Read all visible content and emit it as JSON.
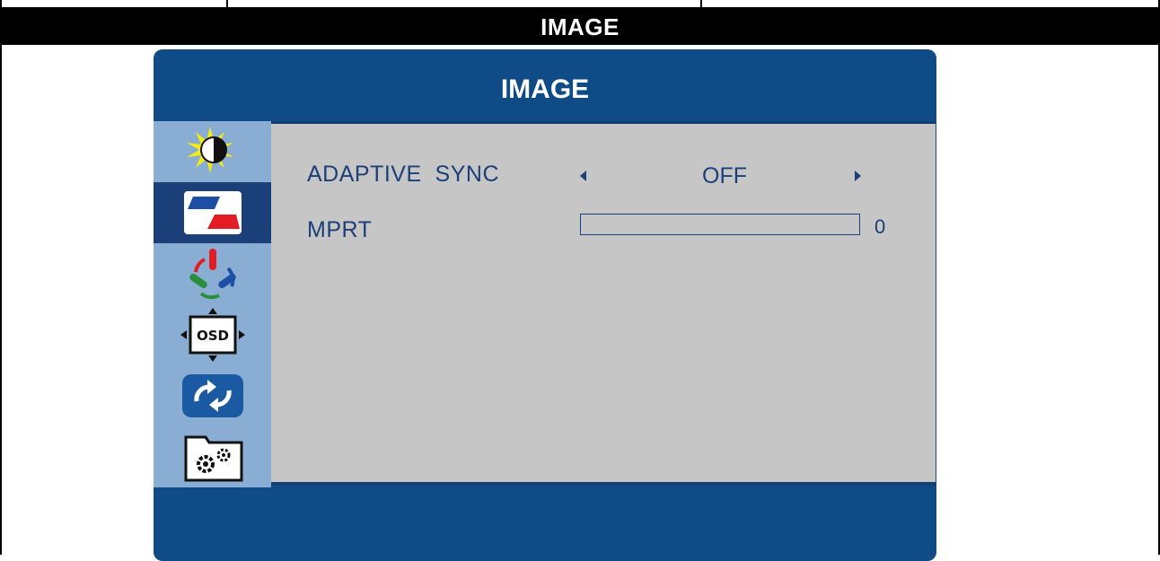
{
  "page": {
    "section_title": "IMAGE"
  },
  "osd": {
    "title": "IMAGE",
    "sidebar": {
      "items": [
        {
          "name": "brightness-contrast",
          "icon": "sun-contrast-icon",
          "active": false
        },
        {
          "name": "image",
          "icon": "image-flag-icon",
          "active": true
        },
        {
          "name": "color",
          "icon": "rgb-color-icon",
          "active": false
        },
        {
          "name": "osd-setup",
          "icon": "osd-position-icon",
          "active": false
        },
        {
          "name": "reset",
          "icon": "refresh-icon",
          "active": false
        },
        {
          "name": "extra",
          "icon": "gears-folder-icon",
          "active": false
        }
      ]
    },
    "settings": [
      {
        "label": "ADAPTIVE  SYNC",
        "value": "OFF"
      },
      {
        "label": "MPRT",
        "value": "0",
        "level": 0
      }
    ]
  },
  "colors": {
    "panel_blue": "#0f4b86",
    "sidebar_light": "#8aaed3",
    "sidebar_active": "#1a3f79",
    "content_gray": "#c6c6c6",
    "text_blue": "#1b3f78"
  }
}
